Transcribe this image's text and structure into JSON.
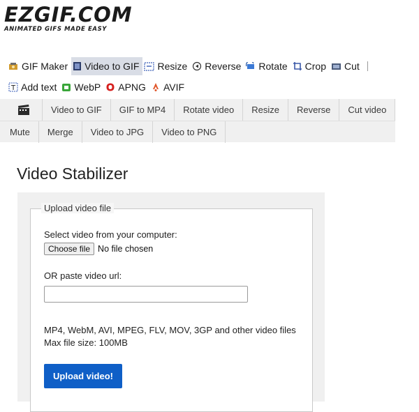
{
  "logo": {
    "main": "EZGIF.COM",
    "tagline": "ANIMATED GIFS MADE EASY"
  },
  "nav": {
    "row1": [
      {
        "label": "GIF Maker",
        "icon": "gif-maker-icon",
        "active": false
      },
      {
        "label": "Video to GIF",
        "icon": "video-to-gif-icon",
        "active": true
      },
      {
        "label": "Resize",
        "icon": "resize-icon",
        "active": false
      },
      {
        "label": "Reverse",
        "icon": "reverse-icon",
        "active": false
      },
      {
        "label": "Rotate",
        "icon": "rotate-icon",
        "active": false
      },
      {
        "label": "Crop",
        "icon": "crop-icon",
        "active": false
      },
      {
        "label": "Cut",
        "icon": "cut-icon",
        "active": false
      }
    ],
    "row2": [
      {
        "label": "Add text",
        "icon": "add-text-icon"
      },
      {
        "label": "WebP",
        "icon": "webp-icon"
      },
      {
        "label": "APNG",
        "icon": "apng-icon"
      },
      {
        "label": "AVIF",
        "icon": "avif-icon"
      }
    ]
  },
  "subnav": {
    "row1": [
      "Video to GIF",
      "GIF to MP4",
      "Rotate video",
      "Resize",
      "Reverse",
      "Cut video"
    ],
    "row2": [
      "Mute",
      "Merge",
      "Video to JPG",
      "Video to PNG"
    ],
    "icon": "film-clapper-icon"
  },
  "page": {
    "title": "Video Stabilizer"
  },
  "form": {
    "legend": "Upload video file",
    "select_label": "Select video from your computer:",
    "choose_button": "Choose file",
    "no_file": "No file chosen",
    "url_label": "OR paste video url:",
    "url_value": "",
    "formats": "MP4, WebM, AVI, MPEG, FLV, MOV, 3GP and other video files",
    "max_size": "Max file size: 100MB",
    "upload_button": "Upload video!"
  },
  "colors": {
    "upload_button": "#0f5fc7",
    "active_nav_bg": "#d9dde6",
    "toolbar_bg": "#f0f0f0"
  }
}
